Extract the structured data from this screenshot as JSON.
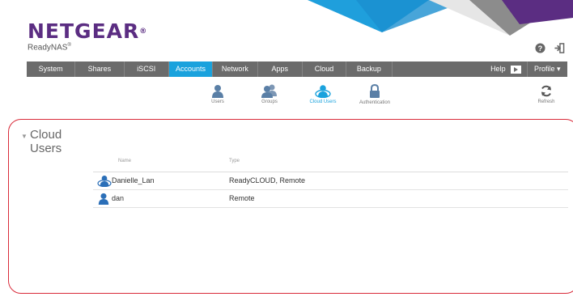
{
  "brand": {
    "name": "NETGEAR",
    "mark": "®",
    "product": "ReadyNAS",
    "product_mark": "®"
  },
  "colors": {
    "brand_purple": "#5b2d82",
    "accent_blue": "#1aa2dd",
    "nav_gray": "#6b6b6b",
    "panel_border": "#d92b3a"
  },
  "top_icons": [
    "help-circle-icon",
    "logout-icon"
  ],
  "nav": {
    "tabs": [
      {
        "label": "System"
      },
      {
        "label": "Shares"
      },
      {
        "label": "iSCSI"
      },
      {
        "label": "Accounts"
      },
      {
        "label": "Network"
      },
      {
        "label": "Apps"
      },
      {
        "label": "Cloud"
      },
      {
        "label": "Backup"
      }
    ],
    "active_tab": "Accounts",
    "help_label": "Help",
    "profile_label": "Profile ▾"
  },
  "subnav": {
    "items": [
      {
        "label": "Users",
        "icon": "user-icon"
      },
      {
        "label": "Groups",
        "icon": "group-icon"
      },
      {
        "label": "Cloud Users",
        "icon": "cloud-user-icon"
      },
      {
        "label": "Authentication",
        "icon": "lock-icon"
      }
    ],
    "active": "Cloud Users",
    "refresh_label": "Refresh"
  },
  "section": {
    "title_line1": "Cloud",
    "title_line2": "Users",
    "toggle": "▼"
  },
  "table": {
    "headers": [
      "Name",
      "Type"
    ],
    "rows": [
      {
        "name": "Danielle_Lan",
        "type": "ReadyCLOUD, Remote",
        "icon": "cloud-user-icon"
      },
      {
        "name": "dan",
        "type": "Remote",
        "icon": "user-icon"
      }
    ]
  }
}
